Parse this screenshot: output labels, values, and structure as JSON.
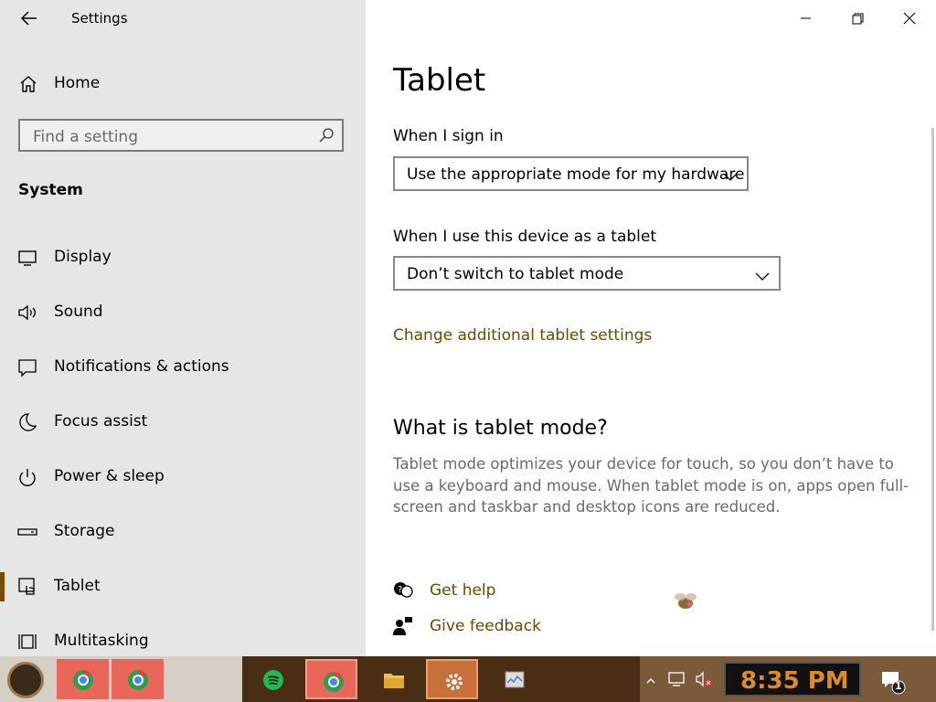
{
  "window": {
    "title": "Settings"
  },
  "sidebar": {
    "home_label": "Home",
    "search_placeholder": "Find a setting",
    "section_label": "System",
    "items": [
      {
        "label": "Display",
        "icon": "monitor-icon"
      },
      {
        "label": "Sound",
        "icon": "speaker-icon"
      },
      {
        "label": "Notifications & actions",
        "icon": "notification-icon"
      },
      {
        "label": "Focus assist",
        "icon": "moon-icon"
      },
      {
        "label": "Power & sleep",
        "icon": "power-icon"
      },
      {
        "label": "Storage",
        "icon": "storage-icon"
      },
      {
        "label": "Tablet",
        "icon": "tablet-icon",
        "active": true
      },
      {
        "label": "Multitasking",
        "icon": "multitasking-icon"
      }
    ]
  },
  "content": {
    "title": "Tablet",
    "sign_in_label": "When I sign in",
    "sign_in_value": "Use the appropriate mode for my hardware",
    "device_label": "When I use this device as a tablet",
    "device_value": "Don’t switch to tablet mode",
    "additional_link": "Change additional tablet settings",
    "what_heading": "What is tablet mode?",
    "description": "Tablet mode optimizes your device for touch, so you don’t have to use a keyboard and mouse. When tablet mode is on, apps open full-screen and taskbar and desktop icons are reduced.",
    "get_help": "Get help",
    "give_feedback": "Give feedback"
  },
  "taskbar": {
    "clock": "8:35 PM",
    "notification_count": "1",
    "apps": [
      "chrome-icon",
      "chrome-icon",
      "spotify-icon",
      "chrome-icon",
      "file-explorer-icon",
      "settings-gear-icon",
      "task-manager-icon"
    ]
  },
  "colors": {
    "accent": "#6b4a00",
    "sidebar_bg": "#e6e6e6",
    "clock": "#d98c2a"
  }
}
